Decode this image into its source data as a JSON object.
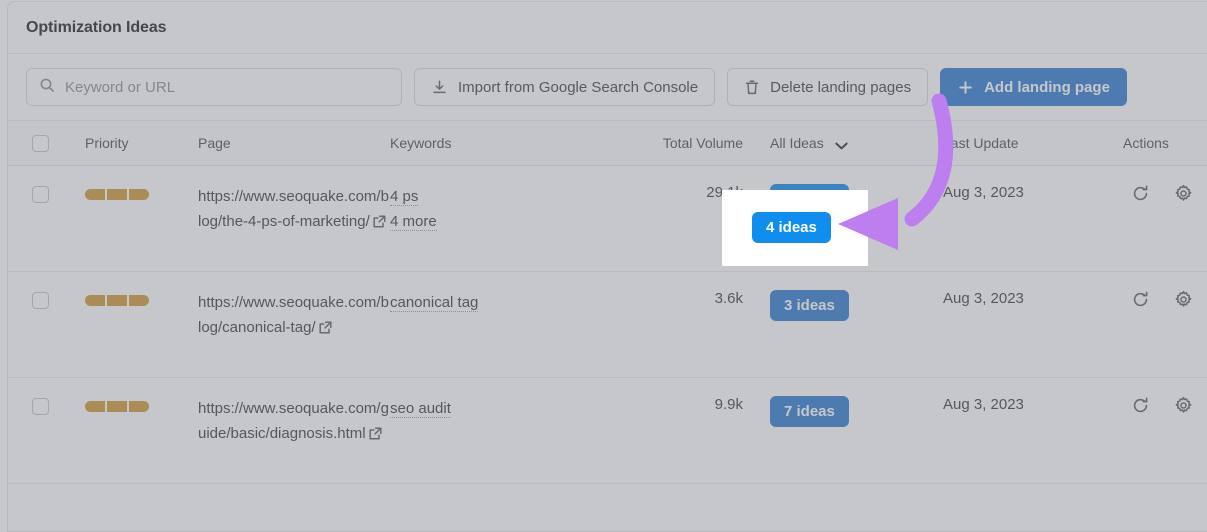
{
  "card": {
    "title": "Optimization Ideas"
  },
  "toolbar": {
    "search": {
      "placeholder": "Keyword or URL",
      "value": "",
      "icon": "search-icon"
    },
    "import_button": {
      "label": "Import from Google Search Console",
      "icon": "download-icon"
    },
    "delete_button": {
      "label": "Delete landing pages",
      "icon": "trash-icon"
    },
    "add_button": {
      "label": "Add landing page",
      "icon": "plus-icon"
    }
  },
  "table": {
    "headers": {
      "select_all": "",
      "priority": "Priority",
      "page": "Page",
      "keywords": "Keywords",
      "total_volume": "Total Volume",
      "ideas_filter": "All Ideas",
      "ideas_filter_icon": "chevron-down-icon",
      "last_update": "Last Update",
      "actions": "Actions"
    },
    "rows": [
      {
        "priority_segments": 3,
        "page_url": "https://www.seoquake.com/blog/the-4-ps-of-marketing/",
        "page_link_icon": "external-link-icon",
        "keywords": [
          "4 ps",
          "4 more"
        ],
        "total_volume": "29.1k",
        "ideas_label": "4 ideas",
        "last_update": "Aug 3, 2023",
        "actions": [
          "refresh-icon",
          "gear-icon"
        ],
        "highlighted": true
      },
      {
        "priority_segments": 3,
        "page_url": "https://www.seoquake.com/blog/canonical-tag/",
        "page_link_icon": "external-link-icon",
        "keywords": [
          "canonical tag"
        ],
        "total_volume": "3.6k",
        "ideas_label": "3 ideas",
        "last_update": "Aug 3, 2023",
        "actions": [
          "refresh-icon",
          "gear-icon"
        ],
        "highlighted": false
      },
      {
        "priority_segments": 3,
        "page_url": "https://www.seoquake.com/guide/basic/diagnosis.html",
        "page_link_icon": "external-link-icon",
        "keywords": [
          "seo audit"
        ],
        "total_volume": "9.9k",
        "ideas_label": "7 ideas",
        "last_update": "Aug 3, 2023",
        "actions": [
          "refresh-icon",
          "gear-icon"
        ],
        "highlighted": false
      }
    ]
  },
  "annotation": {
    "type": "curved-arrow",
    "color": "#bd7ef0",
    "points_to": "4 ideas"
  },
  "colors": {
    "accent_blue": "#2f7dd1",
    "highlight_blue": "#0f8ef0",
    "priority_orange": "#cd9a38",
    "annotation_purple": "#bd7ef0",
    "dim_overlay": "rgba(120,122,128,0.42)"
  }
}
